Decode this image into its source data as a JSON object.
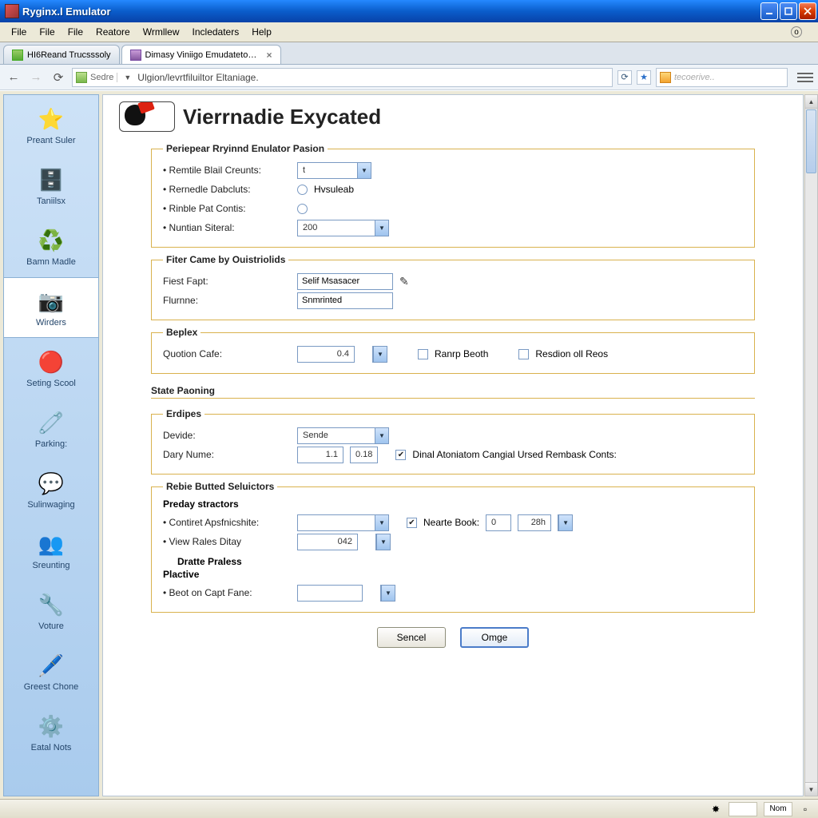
{
  "window": {
    "title": "Ryginx.l Emulator"
  },
  "menu": {
    "items": [
      "File",
      "File",
      "File",
      "Reatore",
      "Wrmllew",
      "Incledaters",
      "Help"
    ]
  },
  "tabs": {
    "inactive": "HI6Reand Trucsssoly",
    "active": "Dimasy Viniigo Emudateton.."
  },
  "address": {
    "secure": "Sedre",
    "path": "Ulgion/levrtfiluiltor Eltaniage."
  },
  "search": {
    "placeholder": "tecoerive.."
  },
  "sidebar": {
    "items": [
      {
        "icon": "⭐",
        "label": "Preant Suler"
      },
      {
        "icon": "🗄️",
        "label": "Taniilsx"
      },
      {
        "icon": "♻️",
        "label": "Bamn Madle"
      },
      {
        "icon": "📷",
        "label": "Wirders"
      },
      {
        "icon": "🔴",
        "label": "Seting Scool"
      },
      {
        "icon": "🧷",
        "label": "Parking:"
      },
      {
        "icon": "💬",
        "label": "Sulinwaging"
      },
      {
        "icon": "👥",
        "label": "Sreunting"
      },
      {
        "icon": "🔧",
        "label": "Voture"
      },
      {
        "icon": "🖊️",
        "label": "Greest Chone"
      },
      {
        "icon": "⚙️",
        "label": "Eatal Nots"
      }
    ],
    "active_index": 3
  },
  "page": {
    "title": "Vierrnadie Exycated"
  },
  "group1": {
    "legend": "Periepear Rryinnd Enulator Pasion",
    "r1_label": "Remtile Blail Creunts:",
    "r1_value": "t",
    "r2_label": "Rernedle Dabcluts:",
    "r2_radio_label": "Hvsuleab",
    "r3_label": "Rinble Pat Contis:",
    "r4_label": "Nuntian Siteral:",
    "r4_value": "200"
  },
  "group2": {
    "legend": "Fiter Came by Ouistriolids",
    "r1_label": "Fiest Fapt:",
    "r1_value": "Selif Msasacer",
    "r2_label": "Flurnne:",
    "r2_value": "Snmrinted"
  },
  "group3": {
    "legend": "Beplex",
    "r1_label": "Quotion Cafe:",
    "r1_value": "0.4",
    "chk1": "Ranrp Beoth",
    "chk2": "Resdion oll Reos"
  },
  "sec_state": {
    "title": "State Paoning"
  },
  "group4": {
    "legend": "Erdipes",
    "r1_label": "Devide:",
    "r1_value": "Sende",
    "r2_label": "Dary Nume:",
    "r2_val_a": "1.1",
    "r2_val_b": "0.18",
    "r2_chk": "Dinal Atoniatom Cangial Ursed Rembask Conts:"
  },
  "group5": {
    "legend": "Rebie Butted Seluictors",
    "sub1": "Preday stractors",
    "r1_label": "Contiret Apsfnicshite:",
    "r1_chk": "Nearte Book:",
    "r1_nb_a": "0",
    "r1_nb_b": "28h",
    "r2_label": "View Rales Ditay",
    "r2_value": "042",
    "sub2": "Dratte Praless",
    "sub3": "Plactive",
    "r3_label": "Beot on Capt Fane:"
  },
  "buttons": {
    "cancel": "Sencel",
    "ok": "Omge"
  },
  "status": {
    "label": "Nom"
  }
}
